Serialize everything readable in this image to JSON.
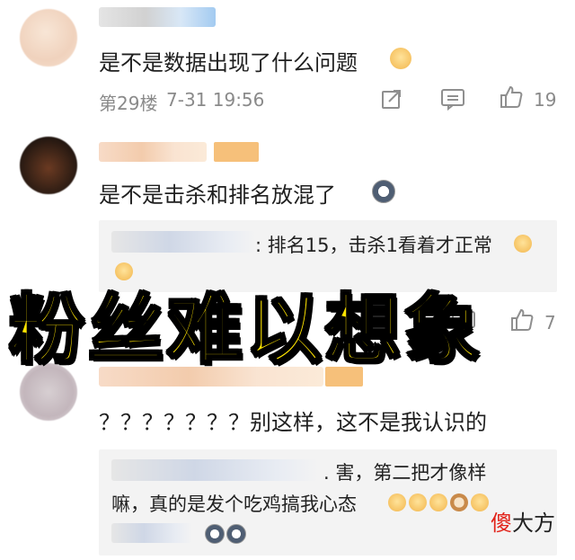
{
  "comments": [
    {
      "text": "是不是数据出现了什么问题",
      "floor": "第29楼",
      "time": "7-31 19:56",
      "likes": "19"
    },
    {
      "text": "是不是击杀和排名放混了",
      "reply": "排名15，击杀1看着才正常",
      "likes": "7"
    },
    {
      "text": "？？？？？？？别这样，这不是我认识的",
      "reply_line1": "害，第二把才像样",
      "reply_line2": "嘛，真的是发个吃鸡搞我心态"
    }
  ],
  "overlay_title": "粉丝难以想象",
  "watermark": {
    "red_char": "傻",
    "rest": "大方"
  },
  "colors": {
    "overlay_fill": "#ffe400",
    "overlay_stroke": "#000000",
    "meta_gray": "#8a8a8a",
    "reply_bg": "#f3f3f3"
  }
}
